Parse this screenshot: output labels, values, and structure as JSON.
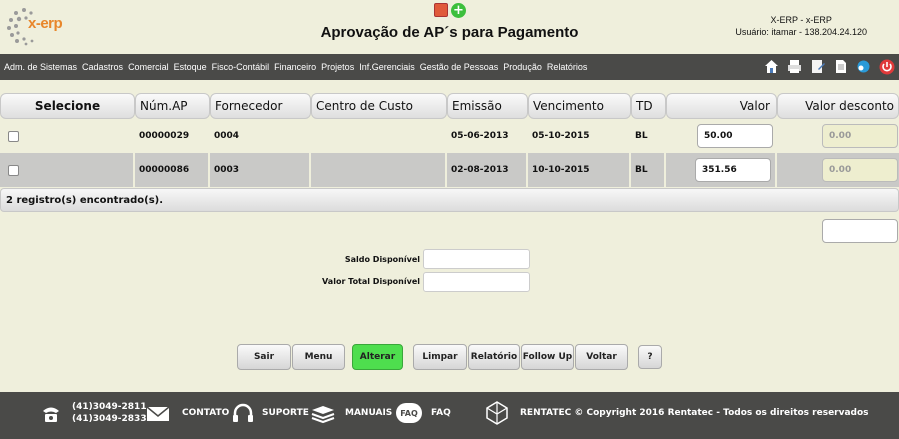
{
  "header": {
    "logo_text": "x-erp",
    "title": "Aprovação de AP´s para Pagamento",
    "system_line1": "X-ERP - x-ERP",
    "system_line2": "Usuário: itamar - 138.204.24.120",
    "add_icon_glyph": "+"
  },
  "menu": {
    "items": [
      "Adm. de Sistemas",
      "Cadastros",
      "Comercial",
      "Estoque",
      "Fisco-Contábil",
      "Financeiro",
      "Projetos",
      "Inf.Gerenciais",
      "Gestão de Pessoas",
      "Produção",
      "Relatórios"
    ],
    "icons": [
      "home-icon",
      "print-icon",
      "edit-icon",
      "document-icon",
      "network-icon",
      "power-icon"
    ]
  },
  "table": {
    "headers": [
      "Selecione",
      "Núm.AP",
      "Fornecedor",
      "Centro de Custo",
      "Emissão",
      "Vencimento",
      "TD",
      "Valor",
      "Valor desconto"
    ],
    "rows": [
      {
        "num_ap": "00000029",
        "fornecedor": "0004",
        "centro_custo": "",
        "emissao": "05-06-2013",
        "vencimento": "05-10-2015",
        "td": "BL",
        "valor": "50.00",
        "desconto": "0.00"
      },
      {
        "num_ap": "00000086",
        "fornecedor": "0003",
        "centro_custo": "",
        "emissao": "02-08-2013",
        "vencimento": "10-10-2015",
        "td": "BL",
        "valor": "351.56",
        "desconto": "0.00"
      }
    ],
    "count": "2 registro(s) encontrado(s)."
  },
  "form": {
    "saldo_label": "Saldo Disponível",
    "valor_total_label": "Valor Total Disponível"
  },
  "buttons": {
    "sair": "Sair",
    "menu": "Menu",
    "alterar": "Alterar",
    "limpar": "Limpar",
    "relatorio": "Relatório",
    "followup": "Follow Up",
    "voltar": "Voltar",
    "help": "?"
  },
  "footer": {
    "phone1": "(41)3049-2811",
    "phone2": "(41)3049-2833",
    "contato": "CONTATO",
    "suporte": "SUPORTE",
    "manuais": "MANUAIS",
    "faq_icon_text": "FAQ",
    "faq": "FAQ",
    "copyright": "RENTATEC © Copyright 2016 Rentatec - Todos os direitos reservados"
  },
  "colors": {
    "accent_green": "#4ede4e",
    "menubar": "#4a4a48",
    "background": "#efefdc",
    "logo": "#e8862a"
  }
}
